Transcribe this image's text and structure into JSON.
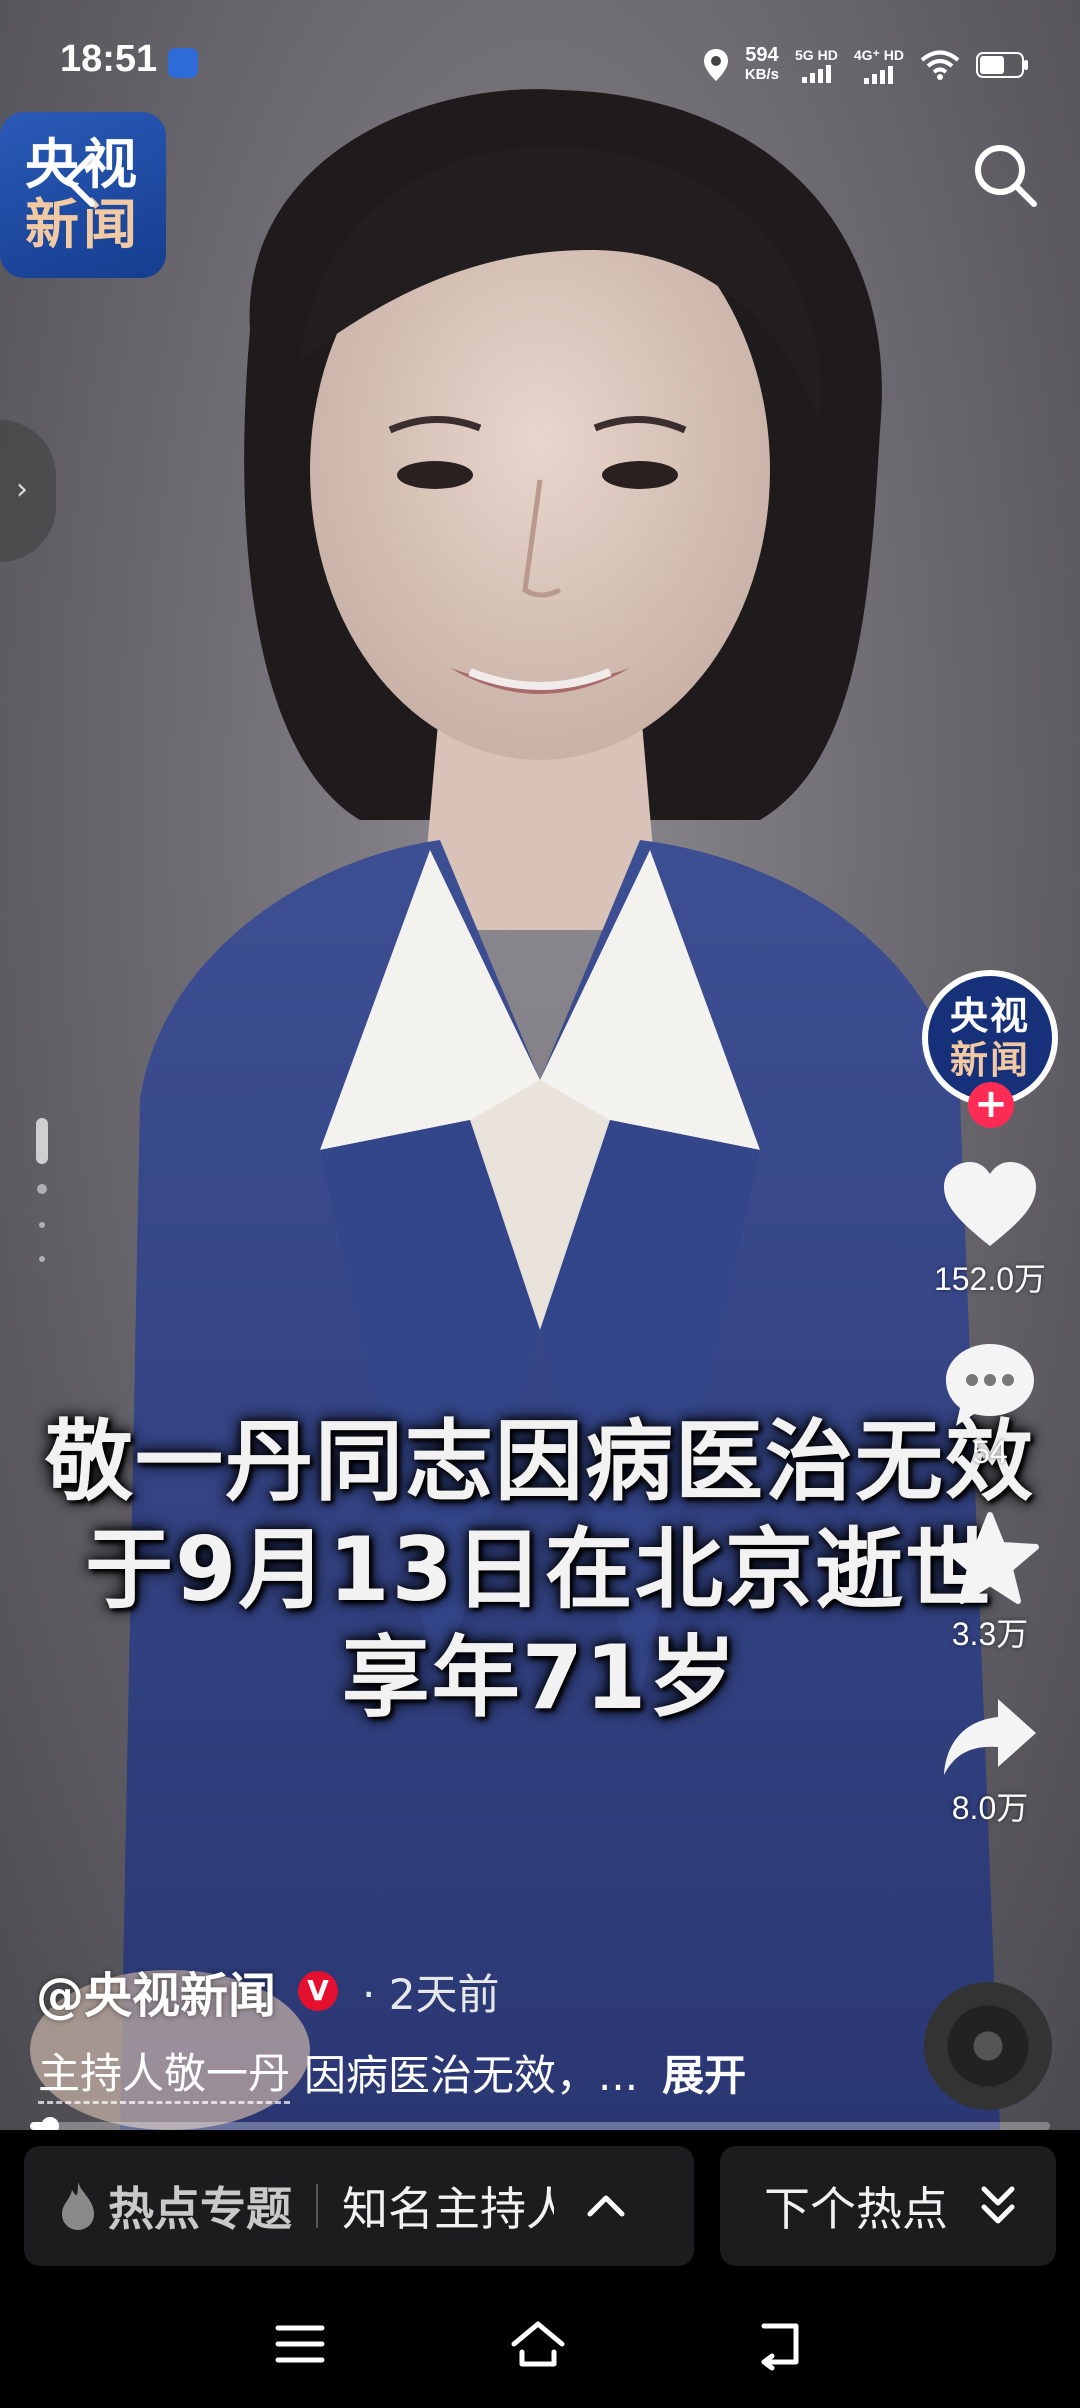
{
  "status_bar": {
    "time": "18:51",
    "net_speed_value": "594",
    "net_speed_unit": "KB/s",
    "sim1": "5G HD",
    "sim2": "4G⁺ HD",
    "icons": [
      "baidu-app-icon",
      "location-icon",
      "signal-icon",
      "wifi-icon",
      "battery-icon"
    ]
  },
  "channel_logo": {
    "line1": "央视",
    "line2": "新闻"
  },
  "video": {
    "caption_lines": [
      "敬一丹同志因病医治无效",
      "于9月13日在北京逝世",
      "享年71岁"
    ]
  },
  "creator_avatar": {
    "line1": "央视",
    "line2": "新闻"
  },
  "actions": {
    "likes": "152.0万",
    "comments": "54",
    "favorites": "3.3万",
    "shares": "8.0万"
  },
  "post": {
    "author": "@央视新闻",
    "verified_mark": "V",
    "posted_time": "· 2天前",
    "desc_highlight": "主持人敬一丹",
    "desc_rest": "因病医治无效，...",
    "expand_label": "展开",
    "progress": 0.02
  },
  "hot_bar": {
    "label": "热点专题",
    "topic": "知名主持人",
    "next_label": "下个热点"
  },
  "colors": {
    "accent": "#fe2c55",
    "verified": "#e5102f",
    "logo_blue": "#1f4fa8",
    "logo_gold": "#f1c9a2"
  }
}
